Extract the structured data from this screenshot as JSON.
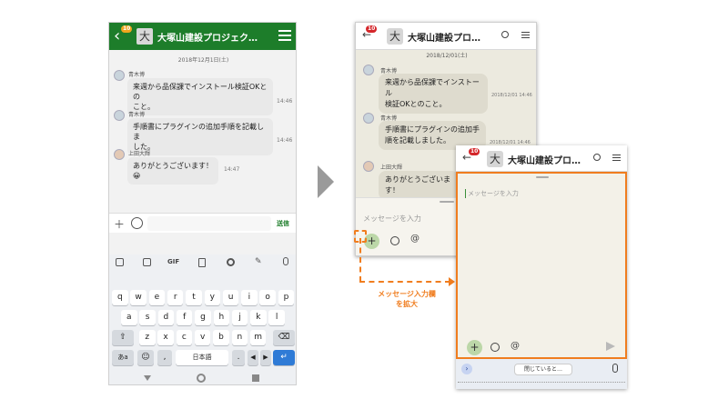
{
  "left_phone": {
    "header": {
      "badge": "10",
      "avatar_char": "大",
      "title": "大塚山建設プロジェク…"
    },
    "date": "2018年12月1日(土)",
    "messages": [
      {
        "name": "青木博",
        "text_line1": "来週から品保課でインストール検証OKとの",
        "text_line2": "こと。",
        "time": "14:46"
      },
      {
        "name": "青木博",
        "text_line1": "手順書にプラグインの追加手順を記載しま",
        "text_line2": "した。",
        "time": "14:46"
      },
      {
        "name": "上田大輝",
        "text_line1": "ありがとうございます！😀",
        "time": "14:47"
      }
    ],
    "input": {
      "plus": "＋",
      "send_label": "送信"
    },
    "keyboard": {
      "toolbar": [
        "GIF"
      ],
      "row1": [
        "q",
        "w",
        "e",
        "r",
        "t",
        "y",
        "u",
        "i",
        "o",
        "p"
      ],
      "row2": [
        "a",
        "s",
        "d",
        "f",
        "g",
        "h",
        "j",
        "k",
        "l"
      ],
      "row3": [
        "z",
        "x",
        "c",
        "v",
        "b",
        "n",
        "m"
      ],
      "mode": "あa",
      "comma": ",",
      "space": "日本語",
      "period": "."
    }
  },
  "middle_phone": {
    "header": {
      "badge": "10",
      "avatar_char": "大",
      "title": "大塚山建設プロ…"
    },
    "date": "2018/12/01(土)",
    "messages": [
      {
        "name": "青木博",
        "text_line1": "来週から品保課でインストール",
        "text_line2": "検証OKとのこと。",
        "time": "2018/12/01 14:46"
      },
      {
        "name": "青木博",
        "text_line1": "手順書にプラグインの追加手",
        "text_line2": "順を記載しました。",
        "time": "2018/12/01 14:46"
      },
      {
        "name": "上田大輝",
        "text_line1": "ありがとうございます！"
      }
    ],
    "input_placeholder": "メッセージを入力"
  },
  "right_phone": {
    "header": {
      "badge": "10",
      "avatar_char": "大",
      "title": "大塚山建設プロ…"
    },
    "input_placeholder": "メッセージを入力",
    "keyboard_chip": "閉じていると…"
  },
  "annotation": {
    "line1": "メッセージ入力欄",
    "line2": "を拡大"
  },
  "colors": {
    "green": "#1d7d2a",
    "orange": "#f07d1f",
    "blue_key": "#2f7bd6"
  }
}
